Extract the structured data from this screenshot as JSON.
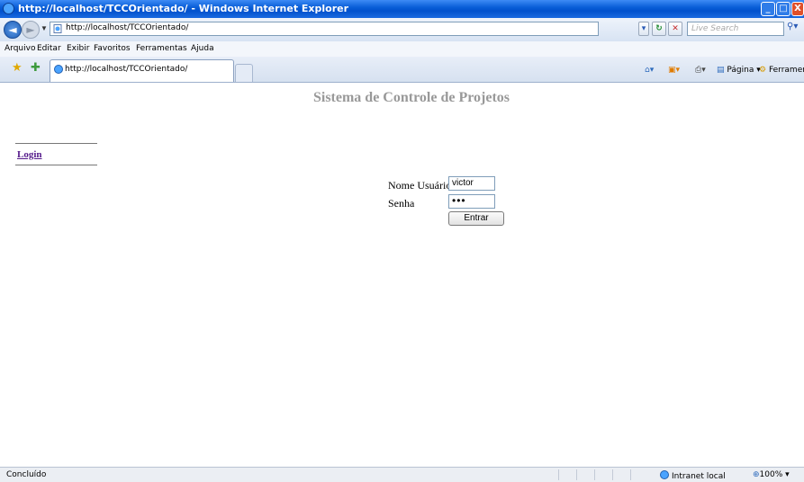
{
  "window": {
    "title": "http://localhost/TCCOrientado/ - Windows Internet Explorer",
    "controls": {
      "minimize": "_",
      "maximize": "□",
      "close": "X"
    }
  },
  "addressbar": {
    "url": "http://localhost/TCCOrientado/",
    "search_placeholder": "Live Search"
  },
  "menu": [
    "Arquivo",
    "Editar",
    "Exibir",
    "Favoritos",
    "Ferramentas",
    "Ajuda"
  ],
  "tab": {
    "label": "http://localhost/TCCOrientado/"
  },
  "commandbar": {
    "page": "Página",
    "tools": "Ferramentas"
  },
  "page": {
    "title": "Sistema de Controle de Projetos",
    "login_link": "Login",
    "username_label": "Nome Usuário",
    "username_value": "victor",
    "password_label": "Senha",
    "password_value": "•••",
    "submit_label": "Entrar"
  },
  "statusbar": {
    "status": "Concluído",
    "zone": "Intranet local",
    "zoom": "100%"
  },
  "icons": [
    "ie-icon",
    "back-icon",
    "forward-icon",
    "page-icon",
    "refresh-icon",
    "stop-icon",
    "search-icon",
    "favorites-star-icon",
    "add-favorites-icon",
    "home-icon",
    "feeds-icon",
    "print-icon",
    "page-menu-icon",
    "tools-gear-icon",
    "globe-icon",
    "zoom-icon"
  ]
}
